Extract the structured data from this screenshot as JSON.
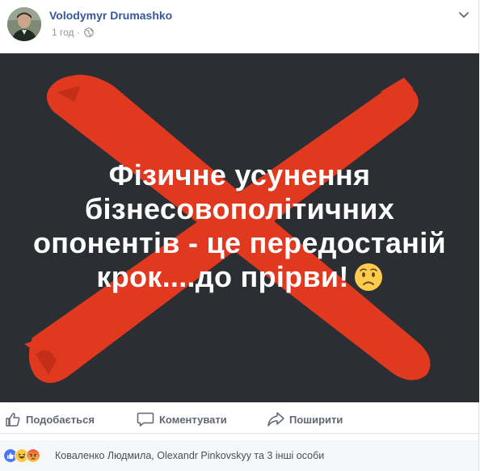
{
  "post": {
    "author": "Volodymyr Drumashko",
    "time": "1 год",
    "separator": "·",
    "privacy_icon": "globe-icon",
    "options_icon": "chevron-down-icon"
  },
  "image": {
    "background": "#2b2e33",
    "cross_color": "#e63a1f",
    "text_lines": [
      "Фізичне усунення",
      "бізнесовополітичних",
      "опонентів - це передостаній",
      "крок....до прірви!"
    ],
    "emoji": "worried-face-icon"
  },
  "actions": {
    "like": "Подобається",
    "comment": "Коментувати",
    "share": "Поширити"
  },
  "reactions": {
    "icons": [
      "like-reaction-icon",
      "haha-reaction-icon",
      "angry-reaction-icon"
    ],
    "summary": "Коваленко Людмила, Olexandr Pinkovskyy та 3 інші особи"
  },
  "colors": {
    "link": "#365899",
    "secondary": "#90949c",
    "action_text": "#606770"
  }
}
